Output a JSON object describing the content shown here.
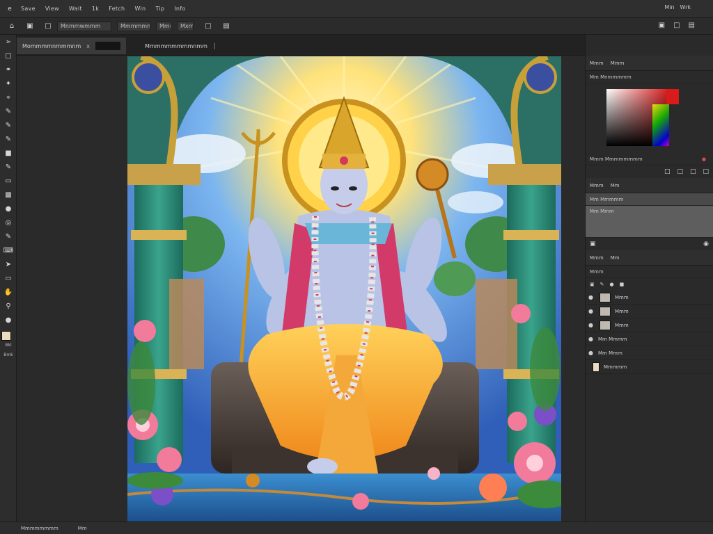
{
  "menubar": {
    "logo": "e",
    "items": [
      "Save",
      "View",
      "Wait",
      "1k",
      "Fetch",
      "Win",
      "Tip",
      "Info"
    ],
    "right": [
      "Min",
      "Wrk"
    ]
  },
  "options_bar": {
    "fields": [
      "Mnmmwmmm",
      "Mmmmmm",
      "Mmm",
      "Mxm"
    ],
    "right_icons": [
      "window-icon",
      "file-icon",
      "document-icon"
    ]
  },
  "document_tabs": {
    "active_label": "Mommmmnmmmnm",
    "active_close": "x",
    "second_label": "Mmmmmmmmmnmm"
  },
  "toolbar": {
    "labels": [
      "Bkl",
      "Bmk"
    ]
  },
  "right_panel": {
    "color_tabs": [
      "Mmm",
      "Mmm"
    ],
    "color_label": "Mm Mnmmmmm",
    "swatches_label": "Mmm Mmmmmmmm",
    "adjust_tabs": [
      "Mmm",
      "Mm"
    ],
    "adjust_rows": [
      "Mm Mmmmm",
      "Mm Mmm"
    ],
    "layers_tabs": [
      "Mmm",
      "Mm"
    ],
    "layers_header": "Mmm",
    "layers": [
      "Mmm",
      "Mmm",
      "Mmm",
      "Mm Mmmm",
      "Mm Mmm",
      "Mmmmm"
    ]
  },
  "status": {
    "zoom": "Mmmmmmmm",
    "info": "Mm"
  },
  "colors": {
    "accent_red": "#d81b1b",
    "panel_bg": "#2a2a2a"
  }
}
